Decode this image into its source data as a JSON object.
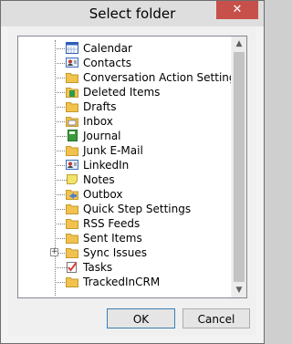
{
  "window": {
    "title": "Select folder",
    "close_label": "✕"
  },
  "tree": {
    "items": [
      {
        "label": "Calendar",
        "icon": "calendar-icon",
        "color": "#2f5fb5"
      },
      {
        "label": "Contacts",
        "icon": "contacts-icon",
        "color": "#3a6fc2"
      },
      {
        "label": "Conversation Action Settings",
        "icon": "folder-icon",
        "color": "#f2c24e"
      },
      {
        "label": "Deleted Items",
        "icon": "deleted-items-icon",
        "color": "#2f9a4a"
      },
      {
        "label": "Drafts",
        "icon": "folder-icon",
        "color": "#f2c24e"
      },
      {
        "label": "Inbox",
        "icon": "inbox-icon",
        "color": "#f2c24e"
      },
      {
        "label": "Journal",
        "icon": "journal-icon",
        "color": "#3b9a3b"
      },
      {
        "label": "Junk E-Mail",
        "icon": "folder-icon",
        "color": "#f2c24e"
      },
      {
        "label": "LinkedIn",
        "icon": "contacts-icon",
        "color": "#3a6fc2"
      },
      {
        "label": "Notes",
        "icon": "notes-icon",
        "color": "#f3e36a"
      },
      {
        "label": "Outbox",
        "icon": "outbox-icon",
        "color": "#4d7fd0"
      },
      {
        "label": "Quick Step Settings",
        "icon": "folder-icon",
        "color": "#f2c24e"
      },
      {
        "label": "RSS Feeds",
        "icon": "folder-icon",
        "color": "#f2c24e"
      },
      {
        "label": "Sent Items",
        "icon": "folder-icon",
        "color": "#f2c24e"
      },
      {
        "label": "Sync Issues",
        "icon": "folder-icon",
        "color": "#f2c24e",
        "expandable": true
      },
      {
        "label": "Tasks",
        "icon": "tasks-icon",
        "color": "#d63d3d"
      },
      {
        "label": "TrackedInCRM",
        "icon": "folder-icon",
        "color": "#f2c24e"
      }
    ]
  },
  "buttons": {
    "ok_label": "OK",
    "cancel_label": "Cancel"
  },
  "scrollbar": {
    "up_glyph": "▲",
    "down_glyph": "▼"
  }
}
